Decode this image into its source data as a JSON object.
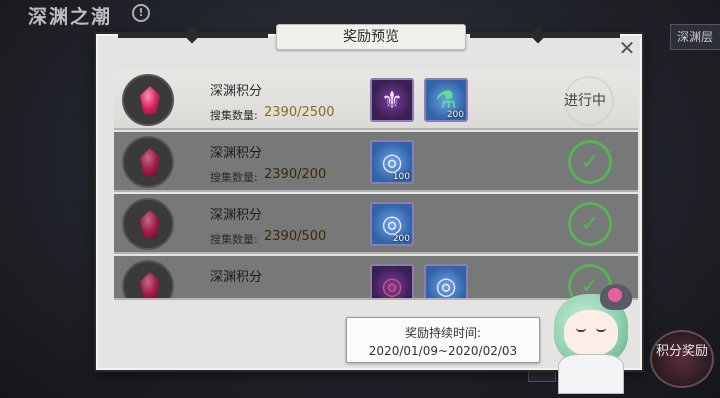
{
  "background": {
    "title": "深渊之潮",
    "info_icon": "info-icon",
    "right_tab": "深渊层",
    "side_button": "积分奖励"
  },
  "dialog": {
    "title": "奖励预览",
    "close_icon": "close-icon"
  },
  "rows": [
    {
      "name": "深渊积分",
      "count_label": "搜集数量:",
      "count_value": "2390/2500",
      "status": "进行中",
      "state": "active",
      "rewards": [
        {
          "icon": "emblem-icon",
          "color": "purple",
          "qty": ""
        },
        {
          "icon": "potion-icon",
          "color": "blue",
          "qty": "200"
        }
      ]
    },
    {
      "name": "深渊积分",
      "count_label": "搜集数量:",
      "count_value": "2390/200",
      "status": "",
      "state": "done",
      "rewards": [
        {
          "icon": "ring-icon",
          "color": "blue",
          "qty": "100"
        }
      ]
    },
    {
      "name": "深渊积分",
      "count_label": "搜集数量:",
      "count_value": "2390/500",
      "status": "",
      "state": "done",
      "rewards": [
        {
          "icon": "ring-icon",
          "color": "blue",
          "qty": "200"
        }
      ]
    },
    {
      "name": "深渊积分",
      "count_label": "",
      "count_value": "",
      "status": "",
      "state": "done",
      "rewards": [
        {
          "icon": "ring-icon",
          "color": "blue",
          "qty": ""
        },
        {
          "icon": "ring-icon",
          "color": "blue",
          "qty": ""
        }
      ]
    }
  ],
  "tooltip": {
    "line1": "奖励持续时间:",
    "line2": "2020/01/09~2020/02/03"
  },
  "colors": {
    "accent_gold": "#8a6a22",
    "done_green": "#4ec24e",
    "gem_pink": "#d6245f"
  }
}
